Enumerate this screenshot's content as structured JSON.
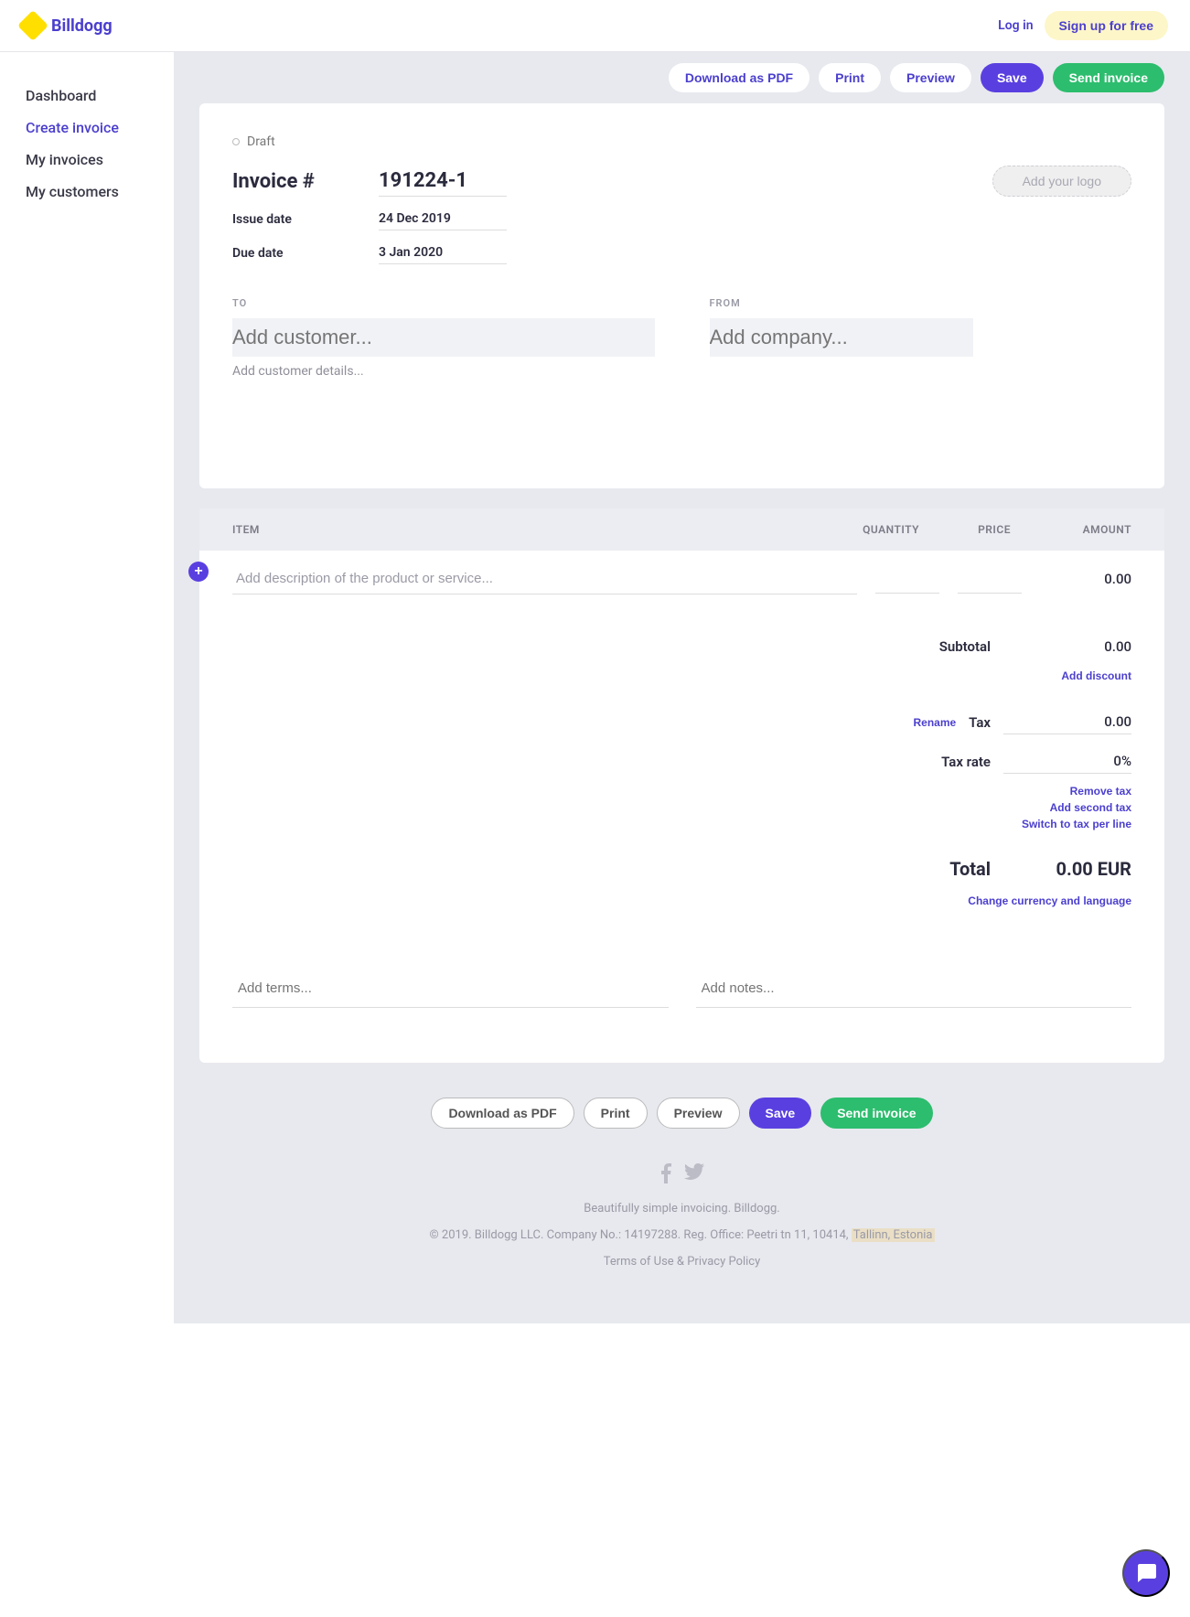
{
  "brand": {
    "name": "Billdogg"
  },
  "header": {
    "login": "Log in",
    "signup": "Sign up for free"
  },
  "nav": {
    "dashboard": "Dashboard",
    "create_invoice": "Create invoice",
    "my_invoices": "My invoices",
    "my_customers": "My customers"
  },
  "actions": {
    "download_pdf": "Download as PDF",
    "print": "Print",
    "preview": "Preview",
    "save": "Save",
    "send": "Send invoice"
  },
  "invoice": {
    "status": "Draft",
    "number_label": "Invoice #",
    "number": "191224-1",
    "issue_label": "Issue date",
    "issue_date": "24 Dec 2019",
    "due_label": "Due date",
    "due_date": "3 Jan 2020",
    "logo_placeholder": "Add your logo",
    "to_label": "TO",
    "to_placeholder": "Add customer...",
    "to_sub": "Add customer details...",
    "from_label": "FROM",
    "from_placeholder": "Add company..."
  },
  "columns": {
    "item": "ITEM",
    "qty": "QUANTITY",
    "price": "PRICE",
    "amount": "AMOUNT"
  },
  "line": {
    "desc_placeholder": "Add description of the product or service...",
    "amount": "0.00"
  },
  "totals": {
    "subtotal_label": "Subtotal",
    "subtotal": "0.00",
    "add_discount": "Add discount",
    "rename": "Rename",
    "tax_label": "Tax",
    "tax": "0.00",
    "tax_rate_label": "Tax rate",
    "tax_rate": "0%",
    "remove_tax": "Remove tax",
    "add_second_tax": "Add second tax",
    "switch_tax": "Switch to tax per line",
    "total_label": "Total",
    "total": "0.00 EUR",
    "change_currency": "Change currency and language"
  },
  "bottom": {
    "terms_placeholder": "Add terms...",
    "notes_placeholder": "Add notes..."
  },
  "footer": {
    "tagline": "Beautifully simple invoicing. Billdogg.",
    "legal_prefix": "© 2019. Billdogg LLC. Company No.: 14197288. Reg. Office: Peetri tn 11, 10414, ",
    "legal_location": "Tallinn, Estonia",
    "terms": "Terms of Use",
    "privacy": "Privacy Policy",
    "amp": " & "
  }
}
